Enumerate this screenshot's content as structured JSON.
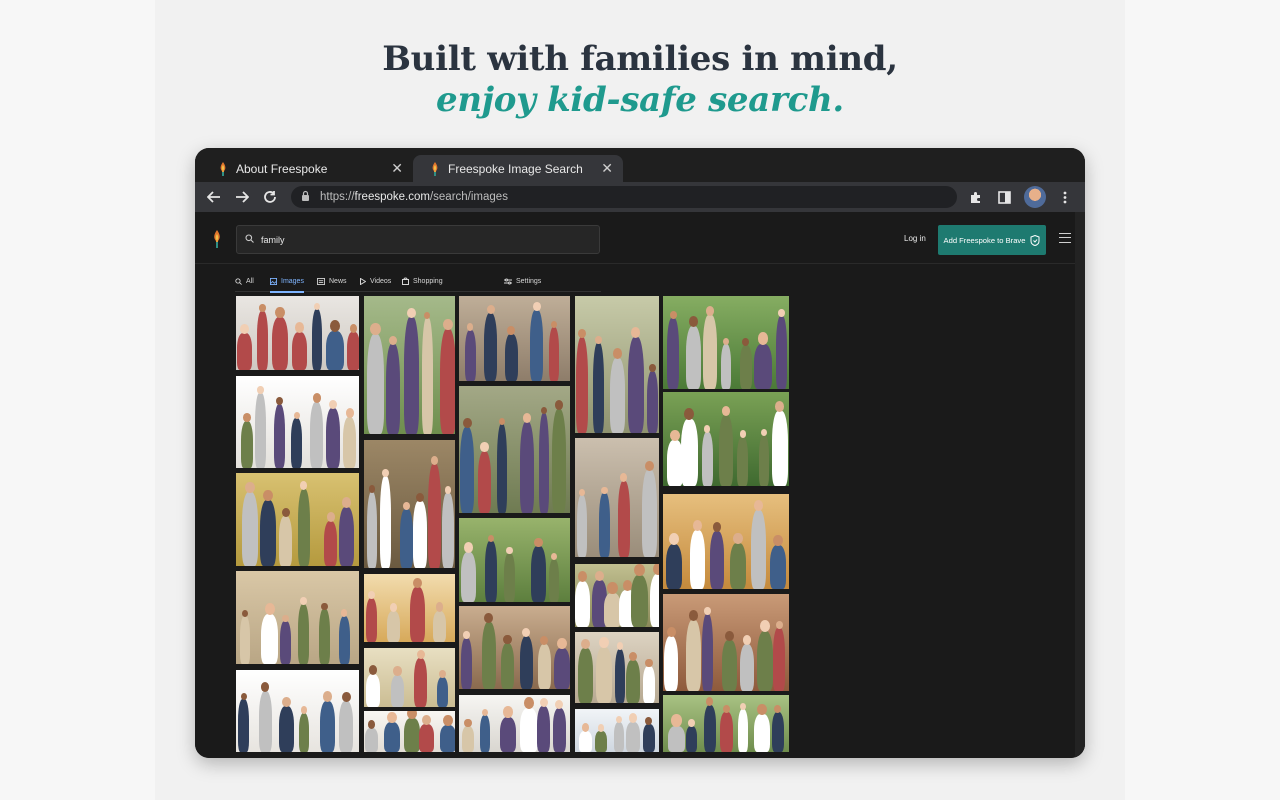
{
  "marketing": {
    "headline_line1": "Built with families in mind,",
    "headline_line2": "enjoy kid-safe search."
  },
  "browser": {
    "tabs": [
      {
        "title": "About Freespoke",
        "close": "✕"
      },
      {
        "title": "Freespoke Image Search",
        "close": "✕"
      }
    ],
    "url_scheme": "https://",
    "url_host": "freespoke.com",
    "url_path": "/search/images",
    "icons": [
      "back-arrow-icon",
      "forward-arrow-icon",
      "reload-icon",
      "lock-icon",
      "extensions-icon",
      "sidepanel-icon",
      "kebab-menu-icon"
    ]
  },
  "site": {
    "search_value": "family",
    "login_label": "Log in",
    "cta_label": "Add Freespoke to Brave",
    "filters": [
      {
        "label": "All",
        "icon": "search-icon"
      },
      {
        "label": "Images",
        "icon": "image-icon"
      },
      {
        "label": "News",
        "icon": "newspaper-icon"
      },
      {
        "label": "Videos",
        "icon": "play-icon"
      },
      {
        "label": "Shopping",
        "icon": "bag-icon"
      },
      {
        "label": "Settings",
        "icon": "sliders-icon"
      }
    ],
    "active_filter": "Images"
  },
  "colors": {
    "brand_teal": "#1e7a70",
    "headline_dark": "#2b3440",
    "headline_teal": "#1f9a8e",
    "active_tab_blue": "#7eb4ff"
  }
}
